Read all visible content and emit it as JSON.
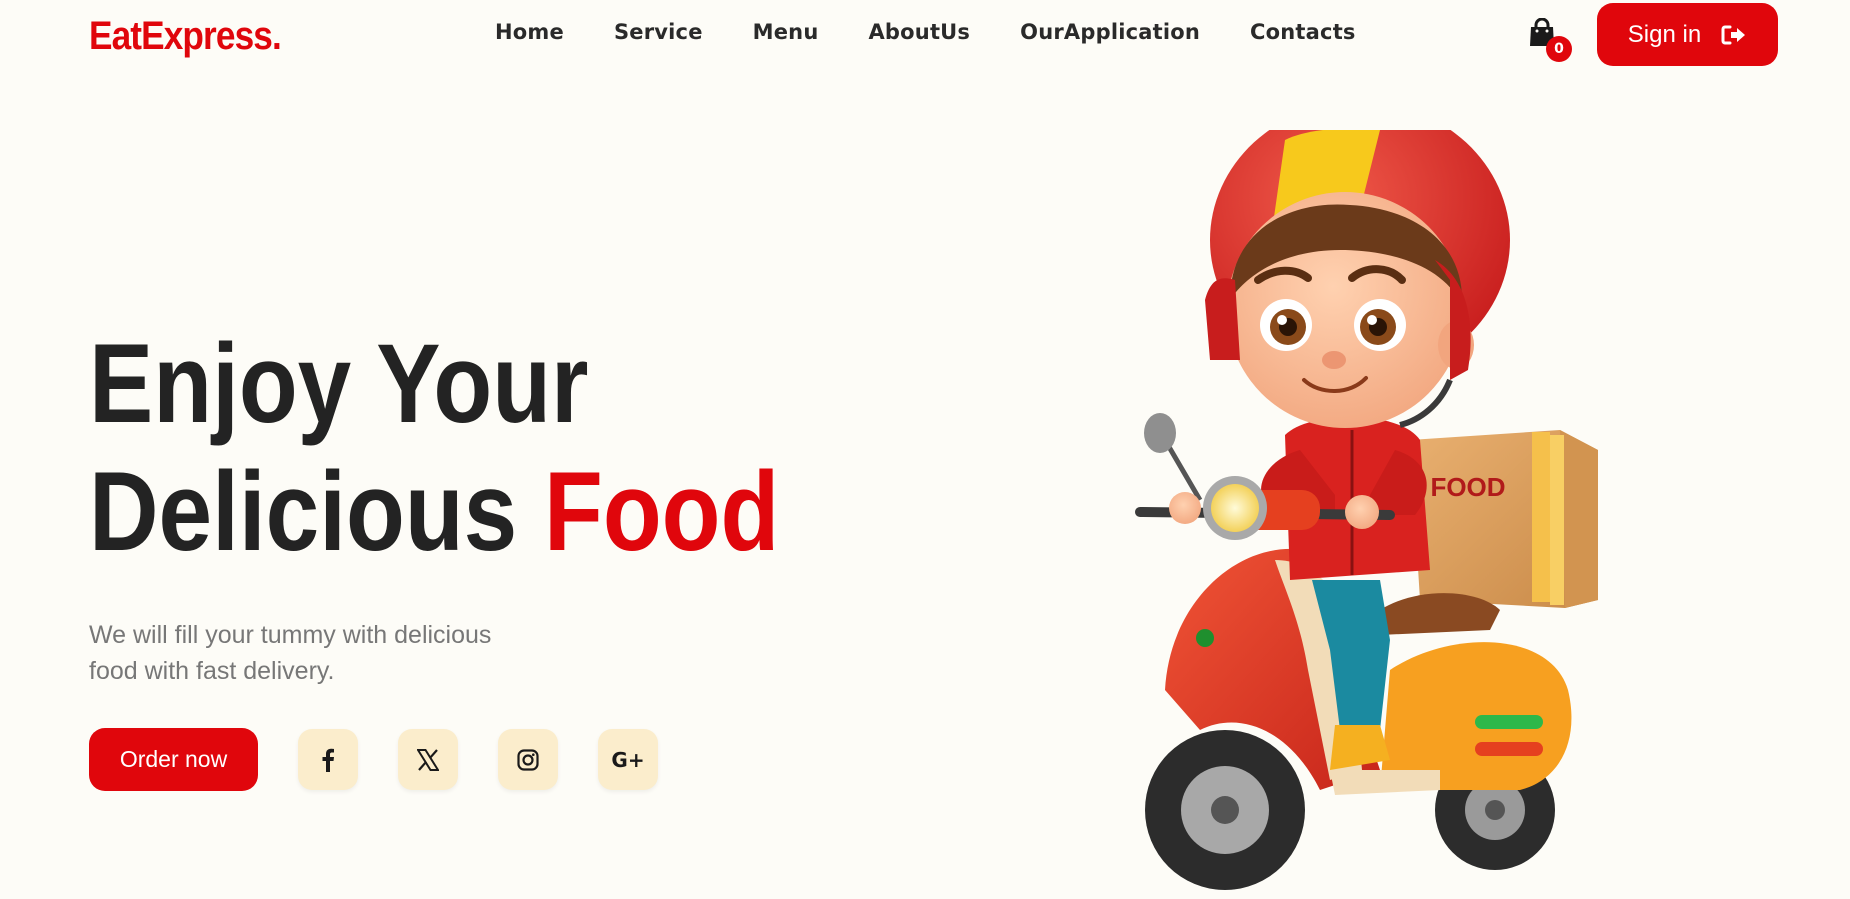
{
  "brand": {
    "name": "EatExpress."
  },
  "nav": {
    "items": [
      {
        "label": "Home"
      },
      {
        "label": "Service"
      },
      {
        "label": "Menu"
      },
      {
        "label": "AboutUs"
      },
      {
        "label": "OurApplication"
      },
      {
        "label": "Contacts"
      }
    ]
  },
  "cart": {
    "count": "0",
    "icon": "shopping-bag-icon"
  },
  "signin": {
    "label": "Sign in",
    "icon": "sign-in-icon"
  },
  "hero": {
    "title_line1": "Enjoy Your",
    "title_line2_plain": "Delicious ",
    "title_line2_accent": "Food",
    "subtitle": "We will fill your tummy with delicious food with fast delivery.",
    "cta_label": "Order now"
  },
  "social": [
    {
      "icon": "facebook-icon"
    },
    {
      "icon": "x-twitter-icon"
    },
    {
      "icon": "instagram-icon"
    },
    {
      "icon": "google-plus-icon",
      "glyph": "G+"
    }
  ],
  "illustration": {
    "box_label": "FOOD"
  },
  "colors": {
    "accent": "#e0060c",
    "background": "#fdfcf7",
    "social_bg": "#fbedcc",
    "text_dark": "#232323",
    "text_muted": "#777777"
  }
}
